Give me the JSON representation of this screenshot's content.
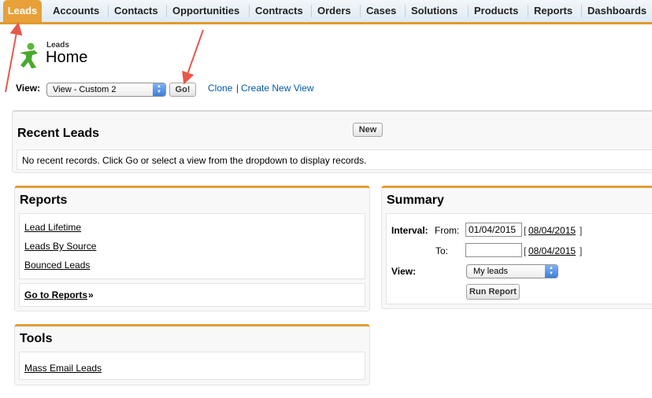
{
  "tabs": [
    "Leads",
    "Accounts",
    "Contacts",
    "Opportunities",
    "Contracts",
    "Orders",
    "Cases",
    "Solutions",
    "Products",
    "Reports",
    "Dashboards"
  ],
  "header": {
    "type": "Leads",
    "title": "Home"
  },
  "view_bar": {
    "label": "View:",
    "selected": "View - Custom 2",
    "go_label": "Go!",
    "clone_label": "Clone",
    "separator": "|",
    "create_label": "Create New View"
  },
  "recent": {
    "title": "Recent Leads",
    "new_label": "New",
    "message": "No recent records. Click Go or select a view from the dropdown to display records."
  },
  "reports": {
    "title": "Reports",
    "links": [
      "Lead Lifetime",
      "Leads By Source",
      "Bounced Leads"
    ],
    "goto_label": "Go to Reports",
    "goto_suffix": "»"
  },
  "tools": {
    "title": "Tools",
    "links": [
      "Mass Email Leads"
    ]
  },
  "summary": {
    "title": "Summary",
    "interval_label": "Interval:",
    "from_label": "From:",
    "to_label": "To:",
    "from_value": "01/04/2015",
    "from_default": "08/04/2015",
    "to_value": "",
    "to_default": "08/04/2015",
    "open_bracket": "[",
    "close_bracket": "]",
    "view_label": "View:",
    "view_selected": "My leads",
    "run_label": "Run Report"
  },
  "colors": {
    "accent": "#e39d35",
    "link": "#015ba7",
    "arrow": "#e8574a"
  }
}
